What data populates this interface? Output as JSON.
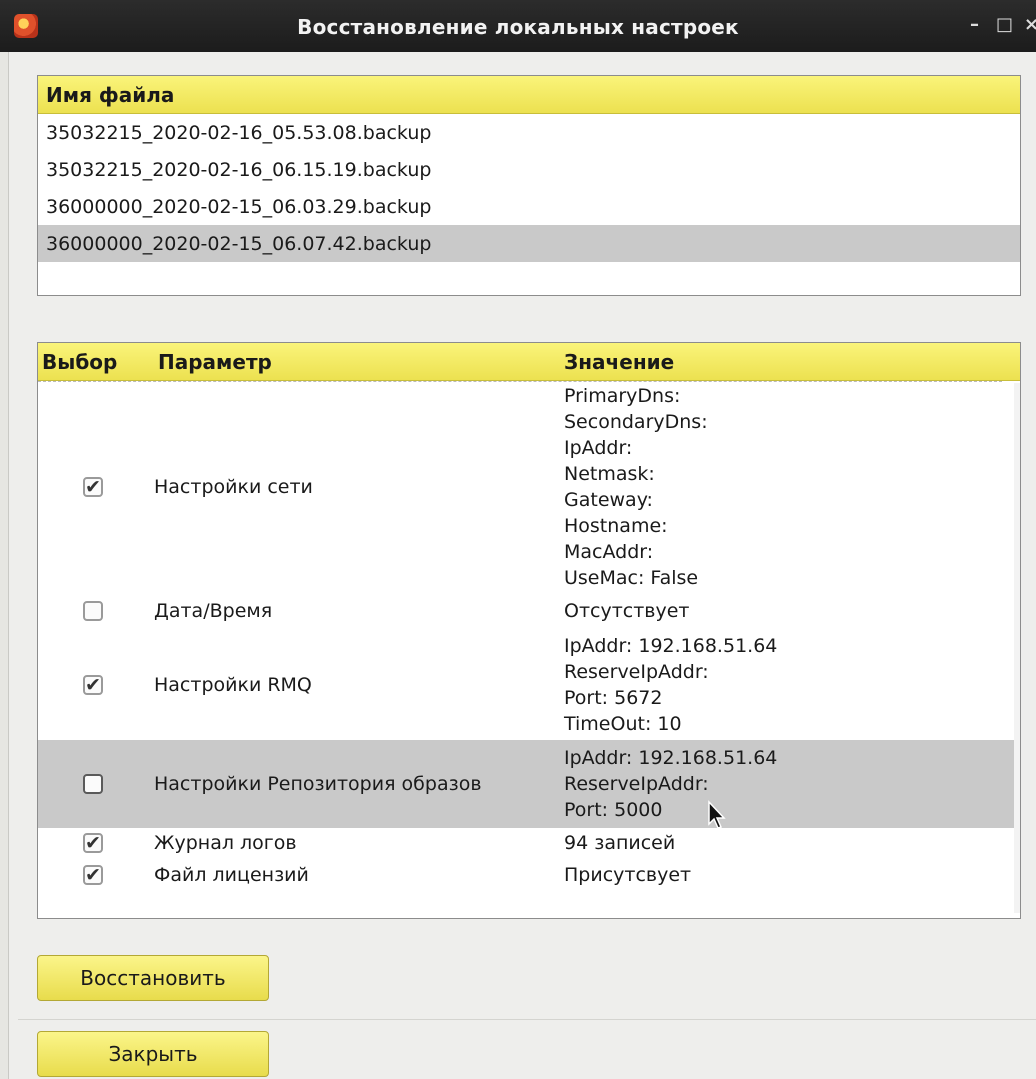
{
  "window": {
    "title": "Восстановление локальных настроек",
    "controls": {
      "minimize": "–",
      "maximize": "□",
      "close": "×"
    }
  },
  "files": {
    "header": "Имя файла",
    "rows": [
      "35032215_2020-02-16_05.53.08.backup",
      "35032215_2020-02-16_06.15.19.backup",
      "36000000_2020-02-15_06.03.29.backup",
      "36000000_2020-02-15_06.07.42.backup"
    ],
    "selected_index": 3
  },
  "params": {
    "headers": {
      "select": "Выбор",
      "param": "Параметр",
      "value": "Значение"
    },
    "rows": [
      {
        "checked": true,
        "param": "Настройки сети",
        "lines": [
          "PrimaryDns:",
          "SecondaryDns:",
          "IpAddr:",
          "Netmask:",
          "Gateway:",
          "Hostname:",
          "MacAddr:",
          "UseMac: False"
        ]
      },
      {
        "checked": false,
        "param": "Дата/Время",
        "lines": [
          "Отсутствует"
        ]
      },
      {
        "checked": true,
        "param": "Настройки RMQ",
        "lines": [
          "IpAddr: 192.168.51.64",
          "ReserveIpAddr:",
          "Port: 5672",
          "TimeOut: 10"
        ]
      },
      {
        "checked": false,
        "param": "Настройки Репозитория образов",
        "lines": [
          "IpAddr: 192.168.51.64",
          "ReserveIpAddr:",
          "Port: 5000"
        ],
        "selected": true
      },
      {
        "checked": true,
        "param": "Журнал логов",
        "lines": [
          "94 записей"
        ]
      },
      {
        "checked": true,
        "param": "Файл лицензий",
        "lines": [
          "Присутсвует"
        ]
      }
    ]
  },
  "buttons": {
    "restore": "Восстановить",
    "close": "Закрыть"
  },
  "colors": {
    "header_yellow": "#f3ea5f",
    "selection_gray": "#c9c9c9",
    "titlebar": "#262626"
  }
}
